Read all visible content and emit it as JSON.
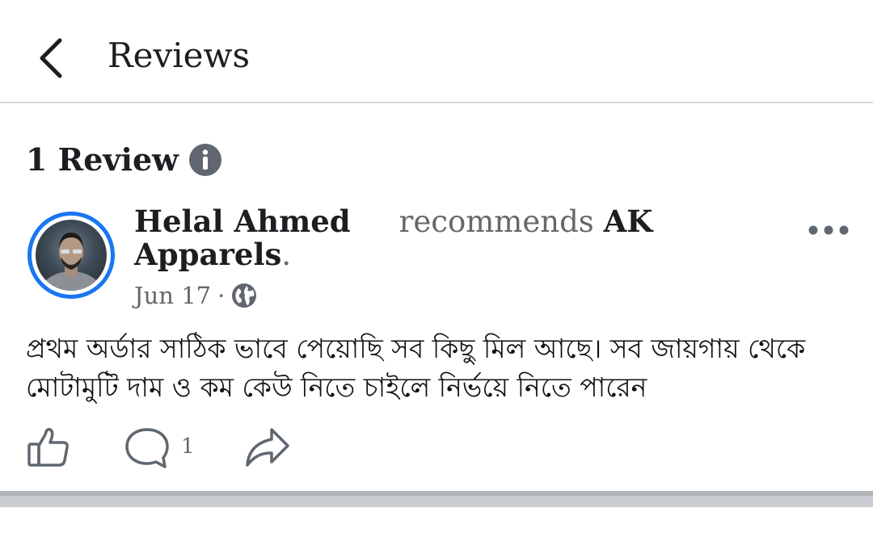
{
  "header": {
    "title": "Reviews",
    "back_icon": "chevron-left-icon"
  },
  "summary": {
    "count_label": "1 Review",
    "info_icon": "info-icon"
  },
  "review": {
    "reviewer_name": "Helal Ahmed",
    "verb": "recommends",
    "page_name": "AK Apparels",
    "date": "Jun 17",
    "privacy_icon": "globe-icon",
    "text": "প্রথম অর্ডার সাঠিক ভাবে পেয়োছি সব কিছু মিল আছে। সব জায়গায় থেকে মোটামুটি দাম ও কম কেউ নিতে চাইলে নির্ভয়ে নিতে পারেন",
    "comment_count": "1"
  },
  "colors": {
    "accent": "#1877f2",
    "text": "#1c1e21",
    "muted": "#65676b",
    "icon": "#606770"
  }
}
